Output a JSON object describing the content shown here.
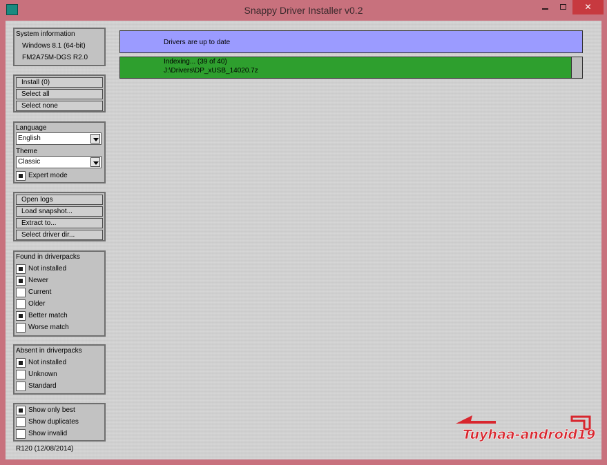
{
  "window": {
    "title": "Snappy Driver Installer v0.2",
    "close_symbol": "✕"
  },
  "colors": {
    "frame": "#c8717d",
    "status_up_to_date": "#9b9bff",
    "status_indexing": "#2e9f2e",
    "close_button": "#c7393f"
  },
  "system_info": {
    "heading": "System information",
    "os": "Windows 8.1 (64-bit)",
    "board": "FM2A75M-DGS R2.0"
  },
  "actions": {
    "install": "Install (0)",
    "select_all": "Select all",
    "select_none": "Select none"
  },
  "settings": {
    "language_label": "Language",
    "language_value": "English",
    "theme_label": "Theme",
    "theme_value": "Classic",
    "expert_mode_label": "Expert mode",
    "expert_mode_checked": true
  },
  "tools": {
    "open_logs": "Open logs",
    "load_snapshot": "Load snapshot...",
    "extract_to": "Extract to...",
    "select_driver_dir": "Select driver dir..."
  },
  "found_filters": {
    "heading": "Found in driverpacks",
    "items": [
      {
        "label": "Not installed",
        "checked": true
      },
      {
        "label": "Newer",
        "checked": true
      },
      {
        "label": "Current",
        "checked": false
      },
      {
        "label": "Older",
        "checked": false
      },
      {
        "label": "Better match",
        "checked": true
      },
      {
        "label": "Worse match",
        "checked": false
      }
    ]
  },
  "absent_filters": {
    "heading": "Absent in driverpacks",
    "items": [
      {
        "label": "Not installed",
        "checked": true
      },
      {
        "label": "Unknown",
        "checked": false
      },
      {
        "label": "Standard",
        "checked": false
      }
    ]
  },
  "view_options": {
    "items": [
      {
        "label": "Show only best",
        "checked": true
      },
      {
        "label": "Show duplicates",
        "checked": false
      },
      {
        "label": "Show invalid",
        "checked": false
      }
    ]
  },
  "revision": "R120 (12/08/2014)",
  "status": {
    "up_to_date": "Drivers are up to date",
    "indexing_line1": "Indexing... (39 of 40)",
    "indexing_line2": "J:\\Drivers\\DP_xUSB_14020.7z"
  },
  "watermark": {
    "text": "Tuyhaa-android19",
    "color": "#d8262e"
  }
}
